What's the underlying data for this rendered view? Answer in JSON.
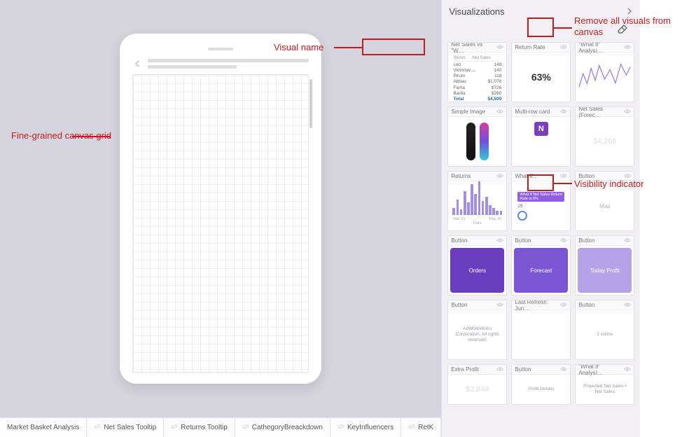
{
  "panel": {
    "title": "Visualizations"
  },
  "annotations": {
    "visual_name": "Visual name",
    "remove_all": "Remove all visuals from canvas",
    "canvas_grid": "Fine-grained canvas grid",
    "visibility": "Visibility indicator"
  },
  "tabs": [
    {
      "label": "Market Basket Analysis",
      "hidden": false
    },
    {
      "label": "Net Sales Tooltip",
      "hidden": true
    },
    {
      "label": "Returns Tooltip",
      "hidden": true
    },
    {
      "label": "CathegoryBreackdown",
      "hidden": true
    },
    {
      "label": "KeyInfluencers",
      "hidden": true
    },
    {
      "label": "RetK",
      "hidden": true
    }
  ],
  "tiles": [
    {
      "id": "net_sales_matrix",
      "title": "Net Sales vs \"W…",
      "kind": "matrix"
    },
    {
      "id": "return_rate",
      "title": "Return Rate",
      "kind": "pct",
      "value": "63%"
    },
    {
      "id": "whatif_analysis_line",
      "title": "\"What If\" Analysi…",
      "kind": "line"
    },
    {
      "id": "simple_image",
      "title": "Simple Image",
      "kind": "image"
    },
    {
      "id": "multi_row_card",
      "title": "Multi-row card",
      "kind": "card"
    },
    {
      "id": "net_sales_forecast",
      "title": "Net Sales (Forec…",
      "kind": "blanknum",
      "value": "$4,200"
    },
    {
      "id": "returns",
      "title": "Returns",
      "kind": "bars"
    },
    {
      "id": "what_if",
      "title": "What If…",
      "kind": "whatif",
      "sub": "25"
    },
    {
      "id": "button_map",
      "title": "Button",
      "kind": "lbl",
      "value": "Map"
    },
    {
      "id": "button_orders",
      "title": "Button",
      "kind": "btn",
      "style": "purple1",
      "value": "Orders"
    },
    {
      "id": "button_forecast",
      "title": "Button",
      "kind": "btn",
      "style": "purple2",
      "value": "Forecast"
    },
    {
      "id": "button_today",
      "title": "Button",
      "kind": "btn",
      "style": "purple3",
      "value": "Today Profit"
    },
    {
      "id": "button_plain1",
      "title": "Button",
      "kind": "tinytext",
      "value": "AdWorkWorks Corporation. All rights reserved."
    },
    {
      "id": "last_refresh",
      "title": "Last Refresh: Jun…",
      "kind": "blank"
    },
    {
      "id": "button_plain2",
      "title": "Button",
      "kind": "tinytext",
      "value": "2 online"
    },
    {
      "id": "extra_profit",
      "title": "Extra Profit",
      "kind": "blanknum",
      "value": "$2,944"
    },
    {
      "id": "button_plain3",
      "title": "Button",
      "kind": "tinytext",
      "value": "Profit Details"
    },
    {
      "id": "whatif_analysis2",
      "title": "\"What If\" Analysi…",
      "kind": "tinytext",
      "value": "Projected Net Sales  •  Net Sales"
    }
  ],
  "matrix": {
    "headers": [
      "Stores",
      "Net Sales"
    ],
    "rows": [
      {
        "label": "Leo",
        "val": "148"
      },
      {
        "label": "Victoriav…",
        "val": "140"
      },
      {
        "label": "Pirum",
        "val": "118"
      },
      {
        "label": "Abbas",
        "val": "$1,076"
      },
      {
        "label": "Fama",
        "val": "$726"
      },
      {
        "label": "Barba",
        "val": "$280"
      }
    ],
    "total": {
      "label": "Total",
      "val": "$4,599"
    }
  },
  "bars": [
    10,
    22,
    8,
    34,
    18,
    44,
    30,
    48,
    20,
    26,
    14,
    10,
    6,
    6
  ],
  "bars_axis": {
    "left": "Mar 21",
    "right": "May 30",
    "xlabel": "Date"
  },
  "whatif_banner": "What If Net Sales Return Rate is 0%"
}
